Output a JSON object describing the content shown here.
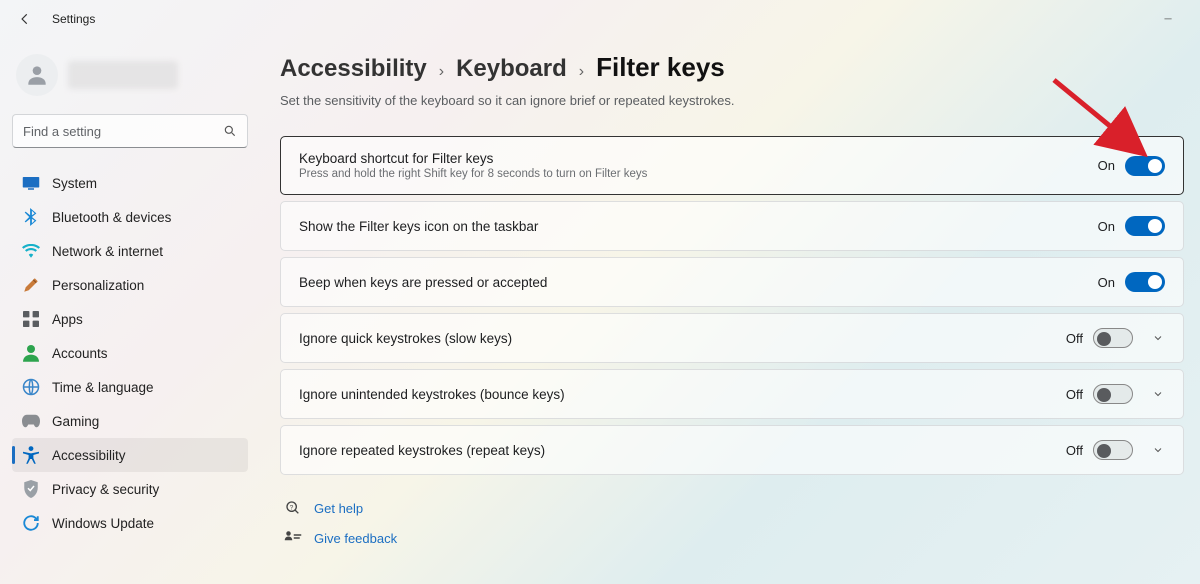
{
  "titlebar": {
    "title": "Settings"
  },
  "search": {
    "placeholder": "Find a setting"
  },
  "nav": {
    "items": [
      {
        "label": "System"
      },
      {
        "label": "Bluetooth & devices"
      },
      {
        "label": "Network & internet"
      },
      {
        "label": "Personalization"
      },
      {
        "label": "Apps"
      },
      {
        "label": "Accounts"
      },
      {
        "label": "Time & language"
      },
      {
        "label": "Gaming"
      },
      {
        "label": "Accessibility"
      },
      {
        "label": "Privacy & security"
      },
      {
        "label": "Windows Update"
      }
    ]
  },
  "breadcrumb": {
    "seg0": "Accessibility",
    "seg1": "Keyboard",
    "seg2": "Filter keys"
  },
  "subtitle": "Set the sensitivity of the keyboard so it can ignore brief or repeated keystrokes.",
  "cards": [
    {
      "title": "Keyboard shortcut for Filter keys",
      "sub": "Press and hold the right Shift key for 8 seconds to turn on Filter keys",
      "state": "On",
      "on": true,
      "expand": false
    },
    {
      "title": "Show the Filter keys icon on the taskbar",
      "state": "On",
      "on": true,
      "expand": false
    },
    {
      "title": "Beep when keys are pressed or accepted",
      "state": "On",
      "on": true,
      "expand": false
    },
    {
      "title": "Ignore quick keystrokes (slow keys)",
      "state": "Off",
      "on": false,
      "expand": true
    },
    {
      "title": "Ignore unintended keystrokes (bounce keys)",
      "state": "Off",
      "on": false,
      "expand": true
    },
    {
      "title": "Ignore repeated keystrokes (repeat keys)",
      "state": "Off",
      "on": false,
      "expand": true
    }
  ],
  "related": {
    "help": "Get help",
    "feedback": "Give feedback"
  }
}
